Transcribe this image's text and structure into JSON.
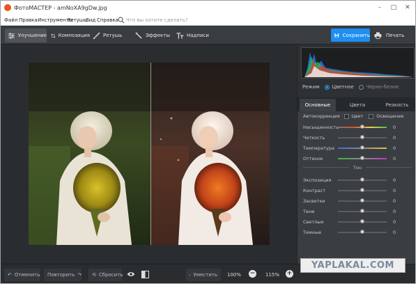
{
  "titlebar": {
    "title": "ФотоМАСТЕР - amNoXA9gDw.jpg",
    "minimize": "–",
    "maximize": "□",
    "close": "✕"
  },
  "menu": {
    "items": [
      "Файл",
      "Правка",
      "Инструменты",
      "Ретушь",
      "Вид",
      "Справка"
    ],
    "search_placeholder": "Что вы хотите сделать?"
  },
  "toolbar": {
    "tabs": [
      {
        "label": "Улучшение",
        "icon": "sliders-icon",
        "active": true
      },
      {
        "label": "Композиция",
        "icon": "crop-icon",
        "active": false
      },
      {
        "label": "Ретушь",
        "icon": "brush-icon",
        "active": false
      },
      {
        "label": "Эффекты",
        "icon": "magic-wand-icon",
        "active": false
      },
      {
        "label": "Надписи",
        "icon": "text-icon",
        "active": false
      }
    ],
    "save_label": "Сохранить",
    "print_label": "Печать",
    "accent_color": "#1f8ef1"
  },
  "panel": {
    "mode_label": "Режим",
    "mode_options": [
      "Цветное",
      "Черно-белое"
    ],
    "mode_selected": "Цветное",
    "tabs": [
      "Основные",
      "Цвета",
      "Резкость"
    ],
    "active_tab": "Основные",
    "autocorrection": {
      "label": "Автокоррекция",
      "color": "Цвет",
      "lighting": "Освещение"
    },
    "tone_title": "Тон",
    "sliders_top": [
      {
        "label": "Насыщенность",
        "value": "0",
        "level": 0.5
      },
      {
        "label": "Четкость",
        "value": "0",
        "level": 0.5
      },
      {
        "label": "Температура",
        "value": "0",
        "level": 0.5
      },
      {
        "label": "Оттенок",
        "value": "0",
        "level": 0.5
      }
    ],
    "sliders_tone": [
      {
        "label": "Экспозиция",
        "value": "0",
        "level": 0.5
      },
      {
        "label": "Контраст",
        "value": "0",
        "level": 0.5
      },
      {
        "label": "Засветки",
        "value": "0",
        "level": 0.5
      },
      {
        "label": "Тени",
        "value": "0",
        "level": 0.5
      },
      {
        "label": "Светлые",
        "value": "0",
        "level": 0.5
      },
      {
        "label": "Темные",
        "value": "0",
        "level": 0.5
      }
    ]
  },
  "bottombar": {
    "undo_label": "Отменить",
    "redo_label": "Повторить",
    "reset_label": "Сбросить",
    "fit_label": "Уместить",
    "zoom_100": "100%",
    "zoom_current": "115%",
    "zoom_minus": "−",
    "zoom_plus": "+"
  },
  "watermark": "YAPLAKAL.COM"
}
